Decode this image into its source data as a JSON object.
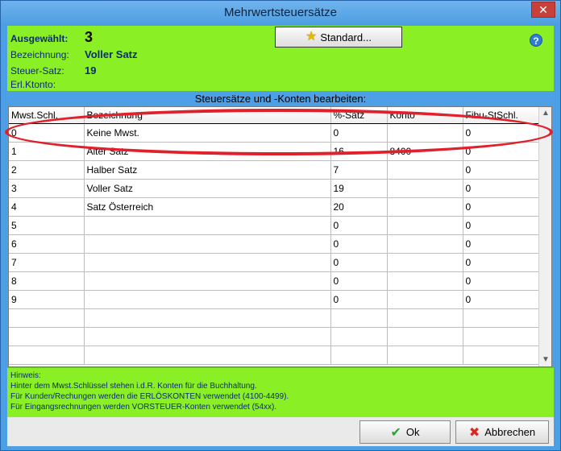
{
  "window": {
    "title": "Mehrwertsteuersätze",
    "close_label": "✕"
  },
  "header": {
    "selected_label": "Ausgewählt:",
    "selected_value": "3",
    "designation_label": "Bezeichnung:",
    "designation_value": "Voller Satz",
    "tax_rate_label": "Steuer-Satz:",
    "tax_rate_value": "19",
    "revenue_account_label": "Erl.Ktonto:",
    "revenue_account_value": "",
    "standard_button": "Standard...",
    "help_label": "?"
  },
  "section_title": "Steuersätze und -Konten bearbeiten:",
  "table": {
    "columns": [
      "Mwst.Schl.",
      "Bezeichnung",
      "%-Satz",
      "Konto",
      "Fibu-StSchl."
    ],
    "rows": [
      [
        "0",
        "Keine Mwst.",
        "0",
        "",
        "0"
      ],
      [
        "1",
        "Alter Satz",
        "16",
        "8400",
        "0"
      ],
      [
        "2",
        "Halber Satz",
        "7",
        "",
        "0"
      ],
      [
        "3",
        "Voller Satz",
        "19",
        "",
        "0"
      ],
      [
        "4",
        "Satz Österreich",
        "20",
        "",
        "0"
      ],
      [
        "5",
        "",
        "0",
        "",
        "0"
      ],
      [
        "6",
        "",
        "0",
        "",
        "0"
      ],
      [
        "7",
        "",
        "0",
        "",
        "0"
      ],
      [
        "8",
        "",
        "0",
        "",
        "0"
      ],
      [
        "9",
        "",
        "0",
        "",
        "0"
      ],
      [
        "",
        "",
        "",
        "",
        ""
      ],
      [
        "",
        "",
        "",
        "",
        ""
      ],
      [
        "",
        "",
        "",
        "",
        ""
      ]
    ]
  },
  "hint": {
    "lines": [
      "Hinweis:",
      "Hinter dem Mwst.Schlüssel stehen i.d.R. Konten für die Buchhaltung.",
      "Für Kunden/Rechungen werden die ERLÖSKONTEN verwendet (4100-4499).",
      "Für Eingangsrechnungen werden VORSTEUER-Konten verwendet (54xx)."
    ]
  },
  "footer": {
    "ok_label": "Ok",
    "cancel_label": "Abbrechen"
  },
  "colors": {
    "panel_green": "#8bef25",
    "window_blue": "#4da0e6",
    "highlight_red": "#e0202a"
  }
}
